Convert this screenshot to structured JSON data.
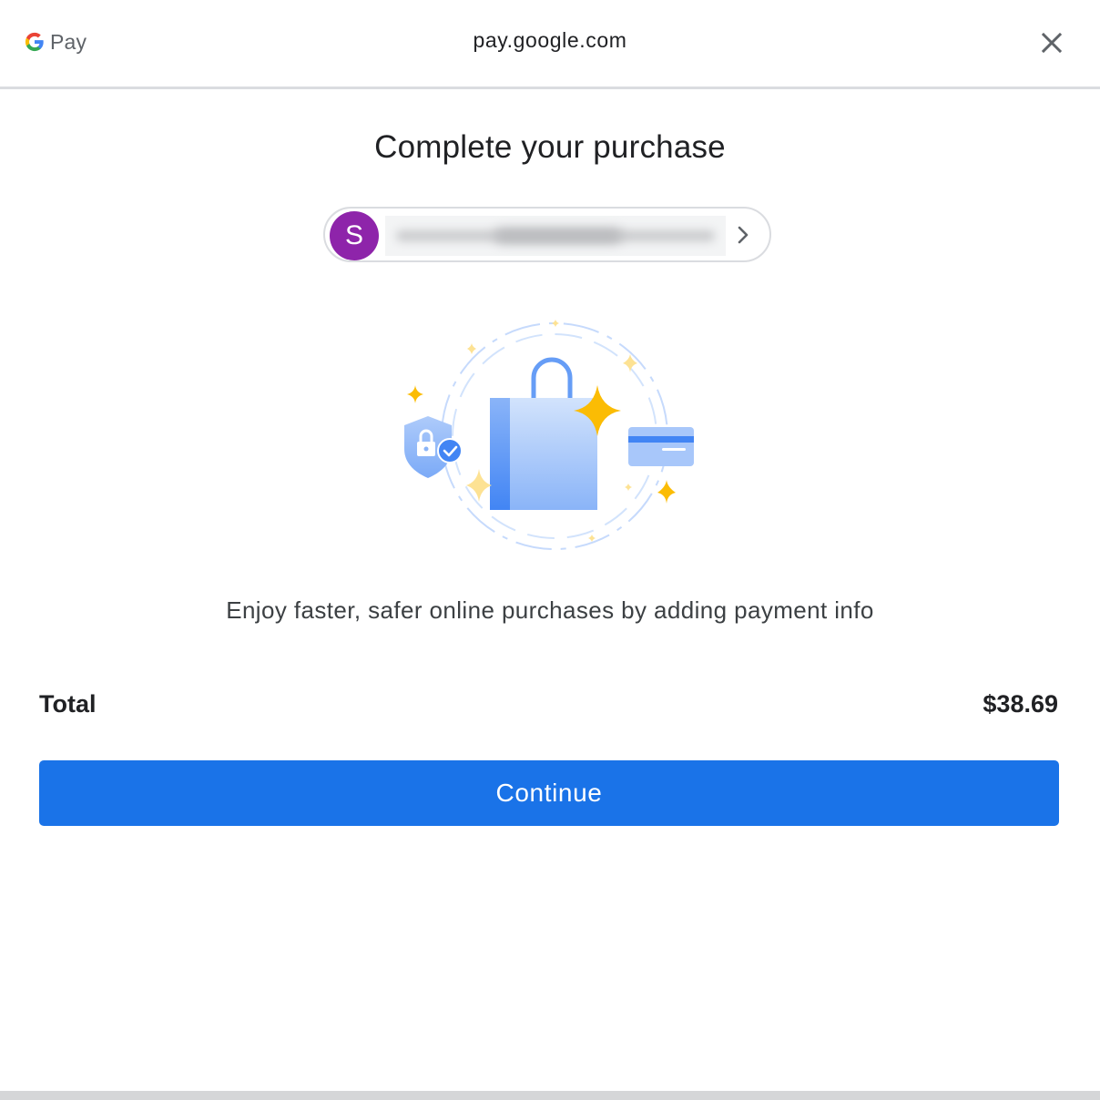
{
  "header": {
    "logo_text": "Pay",
    "domain": "pay.google.com",
    "close_icon": "close-icon"
  },
  "main": {
    "title": "Complete your purchase",
    "account": {
      "avatar_initial": "S",
      "avatar_color": "#8e24aa",
      "email_obscured": true
    },
    "illustration": "shopping-bag-illustration",
    "description": "Enjoy faster, safer online purchases by adding payment info"
  },
  "summary": {
    "total_label": "Total",
    "total_value": "$38.69"
  },
  "actions": {
    "continue_label": "Continue",
    "accent_color": "#1a73e8"
  }
}
